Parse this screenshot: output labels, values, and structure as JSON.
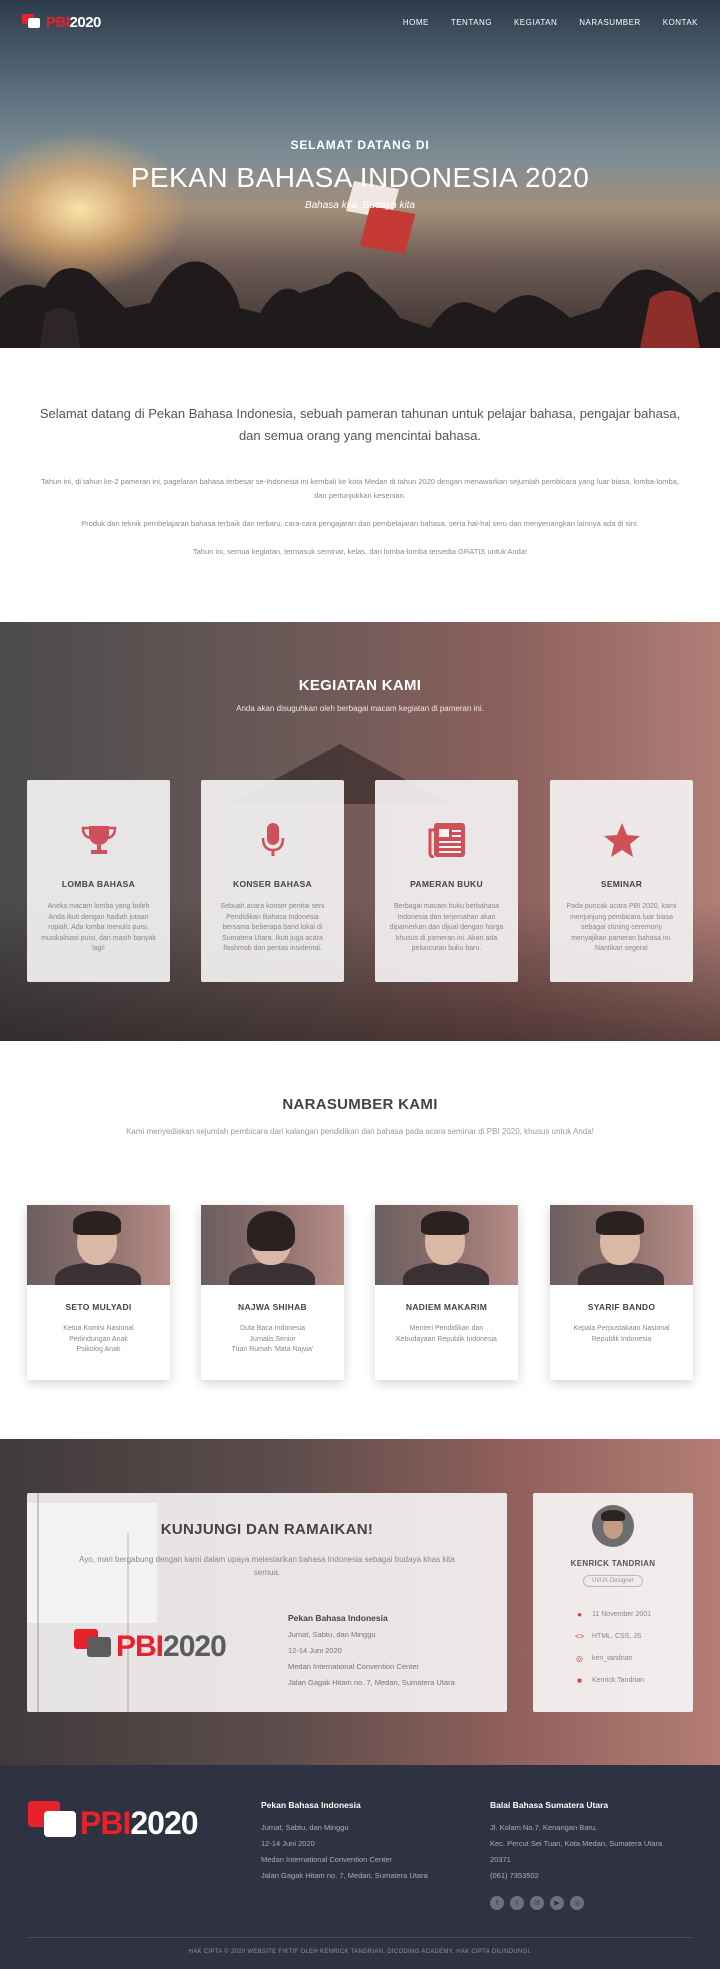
{
  "nav": {
    "logo_pbi": "PBI",
    "logo_year": "2020",
    "menu": [
      "HOME",
      "TENTANG",
      "KEGIATAN",
      "NARASUMBER",
      "KONTAK"
    ]
  },
  "hero": {
    "subtitle": "SELAMAT DATANG DI",
    "title": "PEKAN BAHASA INDONESIA 2020",
    "tagline": "Bahasa kita, Budaya kita"
  },
  "intro": {
    "lead": "Selamat datang di Pekan Bahasa Indonesia, sebuah pameran tahunan untuk pelajar bahasa, pengajar bahasa, dan semua orang yang mencintai bahasa.",
    "p1": "Tahun ini, di tahun ke-2 pameran ini, pagelaran bahasa terbesar se-Indonesia ini kembali ke kota Medan di tahun 2020 dengan menawarkan sejumlah pembicara yang luar biasa, lomba-lomba, dan pertunjukkan kesenian.",
    "p2": "Produk dan teknik pembelajaran bahasa terbaik dan terbaru, cara-cara pengajaran dan pembelajaran bahasa, serta hal-hal seru dan menyenangkan lainnya ada di sini.",
    "p3": "Tahun ini, semua kegiatan, termasuk seminar, kelas, dan lomba-lomba tersedia GRATIS untuk Anda!"
  },
  "kegiatan": {
    "title": "KEGIATAN KAMI",
    "desc": "Anda akan disuguhkan oleh berbagai macam kegiatan di pameran ini.",
    "cards": [
      {
        "title": "LOMBA BAHASA",
        "icon": "trophy-icon",
        "text": "Aneka macam lomba yang boleh Anda ikuti dengan hadiah jutaan rupiah. Ada lomba menulis puisi, musikalisasi puisi, dan masih banyak lagi!"
      },
      {
        "title": "KONSER BAHASA",
        "icon": "microphone-icon",
        "text": "Sebuah acara konser penitai seni Pendidikan Bahasa Indonesia bersama beberapa band lokal di Sumatera Utara. Ikuti juga acara flashmob dan pentas insidental."
      },
      {
        "title": "PAMERAN BUKU",
        "icon": "newspaper-icon",
        "text": "Berbagai macam buku berbahasa Indonesia dan terjemahan akan dipamerkan dan dijual dengan harga khusus di pameran ini. Akan ada peluncuran buku baru."
      },
      {
        "title": "SEMINAR",
        "icon": "star-icon",
        "text": "Pada puncak acara PBI 2020, kami menjunjung pembicara luar biasa sebagai closing ceremony menyajikan pameran bahasa ini. Nantikan segera!"
      }
    ]
  },
  "narasumber": {
    "title": "NARASUMBER KAMI",
    "desc": "Kami menyediakan sejumlah pembicara dari kalangan pendidikan dan bahasa pada acara seminar di PBI 2020, khusus untuk Anda!",
    "people": [
      {
        "name": "SETO MULYADI",
        "lines": [
          "Ketua Komisi Nasional",
          "Perlindungan Anak",
          "Psikolog Anak"
        ]
      },
      {
        "name": "NAJWA SHIHAB",
        "lines": [
          "Duta Baca Indonesia",
          "Jurnalis Senior",
          "Tuan Rumah 'Mata Najwa'"
        ]
      },
      {
        "name": "NADIEM MAKARIM",
        "lines": [
          "Menteri Pendidikan dan",
          "Kebudayaan Republik Indonesia",
          ""
        ]
      },
      {
        "name": "SYARIF BANDO",
        "lines": [
          "Kepala Perpustakaan Nasional",
          "Republik Indonesia",
          ""
        ]
      }
    ]
  },
  "kunjungi": {
    "title": "KUNJUNGI DAN RAMAIKAN!",
    "desc": "Ayo, mari bergabung dengan kami dalam upaya melestarikan bahasa Indonesia sebagai budaya khas kita semua.",
    "logo_pbi": "PBI",
    "logo_year": "2020",
    "info_title": "Pekan Bahasa Indonesia",
    "info_lines": [
      "Jumat, Sabtu, dan Minggu",
      "12-14 Juni 2020",
      "Medan International Convention Center",
      "Jalan Gagak Hitam no. 7, Medan, Sumatera Utara"
    ]
  },
  "profile": {
    "name": "KENRICK TANDRIAN",
    "role": "UI/UX Designer",
    "items": [
      {
        "icon": "birthday-icon",
        "text": "11 November 2001"
      },
      {
        "icon": "code-icon",
        "text": "HTML, CSS, JS"
      },
      {
        "icon": "instagram-icon",
        "text": "ken_tandrian"
      },
      {
        "icon": "linkedin-icon",
        "text": "Kenrick Tandrian"
      }
    ]
  },
  "footer": {
    "logo_pbi": "PBI",
    "logo_year": "2020",
    "col1_title": "Pekan Bahasa Indonesia",
    "col1_lines": [
      "Jumat, Sabtu, dan Minggu",
      "12-14 Juni 2020",
      "Medan International Convention Center",
      "Jalan Gagak Hitam no. 7, Medan, Sumatera Utara"
    ],
    "col2_title": "Balai Bahasa Sumatera Utara",
    "col2_lines": [
      "Jl. Kolam No.7, Kenangan Baru,",
      "Kec. Percut Sei Tuan, Kota Medan, Sumatera Utara",
      "20371",
      "(061) 7353502"
    ],
    "social": [
      "facebook-icon",
      "twitter-icon",
      "email-icon",
      "youtube-icon",
      "instagram-icon"
    ],
    "copyright": "HAK CIPTA © 2020 WEBSITE FIKTIF OLEH KENRICK TANDRIAN, DICODING ACADEMY. HAK CIPTA DILINDUNGI."
  },
  "colors": {
    "brand_red": "#e8212b",
    "accent_rose": "#d0505a",
    "footer_bg": "#2e3241"
  }
}
